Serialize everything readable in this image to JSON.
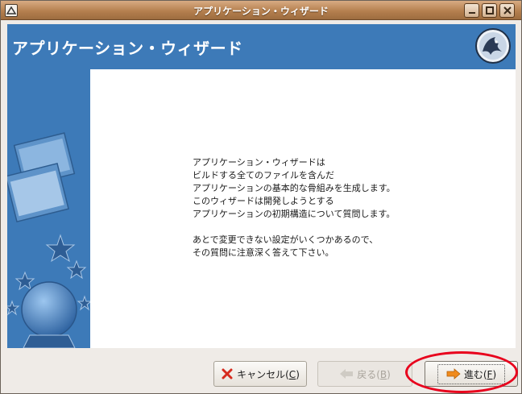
{
  "window": {
    "title": "アプリケーション・ウィザード"
  },
  "header": {
    "heading": "アプリケーション・ウィザード"
  },
  "intro": {
    "lines": [
      "アプリケーション・ウィザードは",
      "ビルドする全てのファイルを含んだ",
      "アプリケーションの基本的な骨組みを生成します。",
      "このウィザードは開発しようとする",
      "アプリケーションの初期構造について質問します。",
      "",
      "あとで変更できない設定がいくつかあるので、",
      "その質問に注意深く答えて下さい。"
    ]
  },
  "buttons": {
    "cancel": {
      "label": "キャンセル(",
      "mnemonic": "C",
      "suffix": ")"
    },
    "back": {
      "label": "戻る(",
      "mnemonic": "B",
      "suffix": ")"
    },
    "forward": {
      "label": "進む(",
      "mnemonic": "F",
      "suffix": ")"
    }
  },
  "colors": {
    "titlebar": "#b5804f",
    "accent": "#3d7ab8",
    "annotation": "#e8001c"
  },
  "icons": {
    "window": "app-icon",
    "minimize": "minimize-icon",
    "maximize": "maximize-icon",
    "close": "close-icon",
    "logo": "wizard-logo-icon",
    "cancel": "cancel-x-icon",
    "back": "arrow-left-icon",
    "forward": "arrow-right-icon"
  }
}
